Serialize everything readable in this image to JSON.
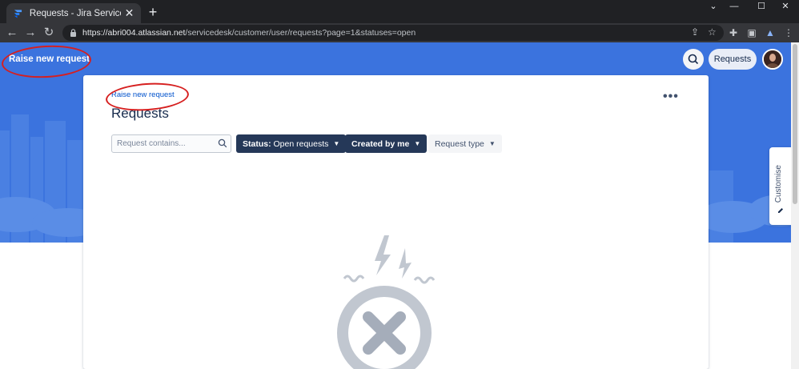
{
  "browser": {
    "tab_title": "Requests - Jira Service Managem",
    "url_host": "https://abri004.atlassian.net",
    "url_path": "/servicedesk/customer/user/requests?page=1&statuses=open"
  },
  "header": {
    "help_center_name": "Raise new request",
    "requests_label": "Requests"
  },
  "main": {
    "breadcrumb_link": "Raise new request",
    "title": "Requests",
    "search": {
      "placeholder": "Request contains...",
      "value": ""
    },
    "filters": {
      "status_label": "Status:",
      "status_value": "Open requests",
      "created_by": "Created by me",
      "request_type": "Request type"
    }
  },
  "sidebar_tab": {
    "label": "Customise"
  },
  "colors": {
    "banner": "#3b73de",
    "annotation": "#d61f1f",
    "filter_dark": "#253858",
    "link": "#0052cc"
  },
  "icons": [
    "jira-favicon",
    "back-icon",
    "forward-icon",
    "reload-icon",
    "lock-icon",
    "share-icon",
    "bookmark-star-icon",
    "extensions-icon",
    "sidepanel-icon",
    "profile-icon",
    "kebab-icon",
    "search-icon",
    "more-icon",
    "chevron-down-icon",
    "pencil-icon",
    "empty-state-icon"
  ]
}
